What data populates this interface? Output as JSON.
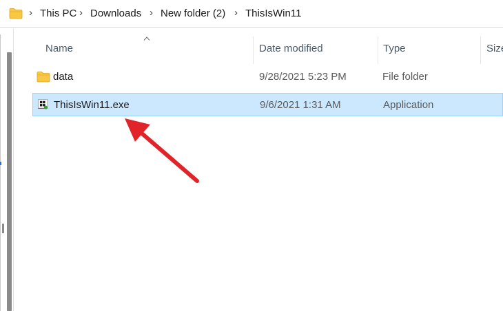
{
  "address_bar": {
    "folder_icon": "folder-icon",
    "breadcrumbs": [
      "This PC",
      "Downloads",
      "New folder (2)",
      "ThisIsWin11"
    ]
  },
  "columns": {
    "name": "Name",
    "date_modified": "Date modified",
    "type": "Type",
    "size": "Size"
  },
  "rows": [
    {
      "name": "data",
      "date_modified": "9/28/2021 5:23 PM",
      "type": "File folder",
      "icon": "folder-icon",
      "selected": false
    },
    {
      "name": "ThisIsWin11.exe",
      "date_modified": "9/6/2021 1:31 AM",
      "type": "Application",
      "icon": "application-icon",
      "selected": true
    }
  ],
  "colors": {
    "selection_bg": "#cce8ff",
    "selection_border": "#99d1ff",
    "annotation_arrow": "#e0242a",
    "folder_yellow": "#f8c845"
  }
}
